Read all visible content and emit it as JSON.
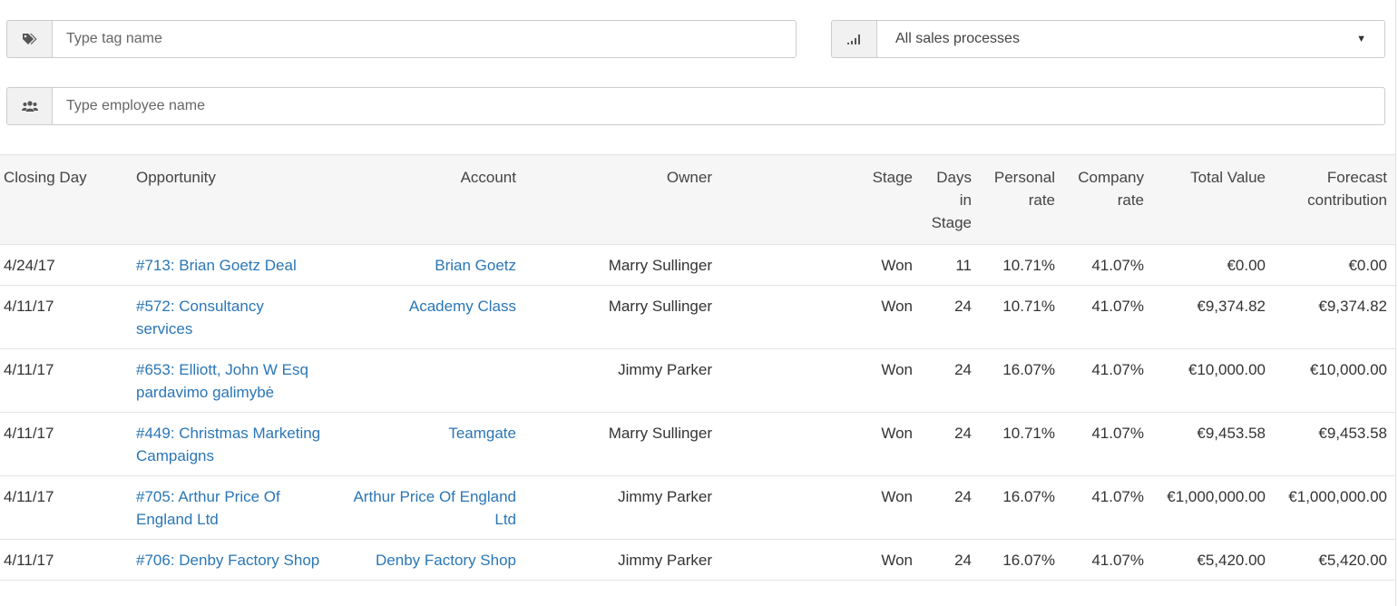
{
  "filters": {
    "tag_placeholder": "Type tag name",
    "tag_icon": "tags-icon",
    "process_icon": "signal-bars-icon",
    "process_selected": "All sales processes",
    "employee_placeholder": "Type employee name",
    "employee_icon": "users-icon"
  },
  "table": {
    "headers": {
      "closing_day": "Closing Day",
      "opportunity": "Opportunity",
      "account": "Account",
      "owner": "Owner",
      "stage": "Stage",
      "days_in_stage": "Days in Stage",
      "personal_rate": "Personal rate",
      "company_rate": "Company rate",
      "total_value": "Total Value",
      "forecast_contribution": "Forecast contribution"
    },
    "rows": [
      {
        "closing_day": "4/24/17",
        "opportunity": "#713: Brian Goetz Deal",
        "account": "Brian Goetz",
        "owner": "Marry Sullinger",
        "stage": "Won",
        "days": "11",
        "personal_rate": "10.71%",
        "company_rate": "41.07%",
        "total_value": "€0.00",
        "forecast": "€0.00"
      },
      {
        "closing_day": "4/11/17",
        "opportunity": "#572: Consultancy services",
        "account": "Academy Class",
        "owner": "Marry Sullinger",
        "stage": "Won",
        "days": "24",
        "personal_rate": "10.71%",
        "company_rate": "41.07%",
        "total_value": "€9,374.82",
        "forecast": "€9,374.82"
      },
      {
        "closing_day": "4/11/17",
        "opportunity": "#653: Elliott, John W Esq pardavimo galimybė",
        "account": "",
        "owner": "Jimmy Parker",
        "stage": "Won",
        "days": "24",
        "personal_rate": "16.07%",
        "company_rate": "41.07%",
        "total_value": "€10,000.00",
        "forecast": "€10,000.00"
      },
      {
        "closing_day": "4/11/17",
        "opportunity": "#449: Christmas Marketing Campaigns",
        "account": "Teamgate",
        "owner": "Marry Sullinger",
        "stage": "Won",
        "days": "24",
        "personal_rate": "10.71%",
        "company_rate": "41.07%",
        "total_value": "€9,453.58",
        "forecast": "€9,453.58"
      },
      {
        "closing_day": "4/11/17",
        "opportunity": "#705: Arthur Price Of England Ltd",
        "account": "Arthur Price Of England Ltd",
        "owner": "Jimmy Parker",
        "stage": "Won",
        "days": "24",
        "personal_rate": "16.07%",
        "company_rate": "41.07%",
        "total_value": "€1,000,000.00",
        "forecast": "€1,000,000.00"
      },
      {
        "closing_day": "4/11/17",
        "opportunity": "#706: Denby Factory Shop",
        "account": "Denby Factory Shop",
        "owner": "Jimmy Parker",
        "stage": "Won",
        "days": "24",
        "personal_rate": "16.07%",
        "company_rate": "41.07%",
        "total_value": "€5,420.00",
        "forecast": "€5,420.00"
      }
    ]
  }
}
